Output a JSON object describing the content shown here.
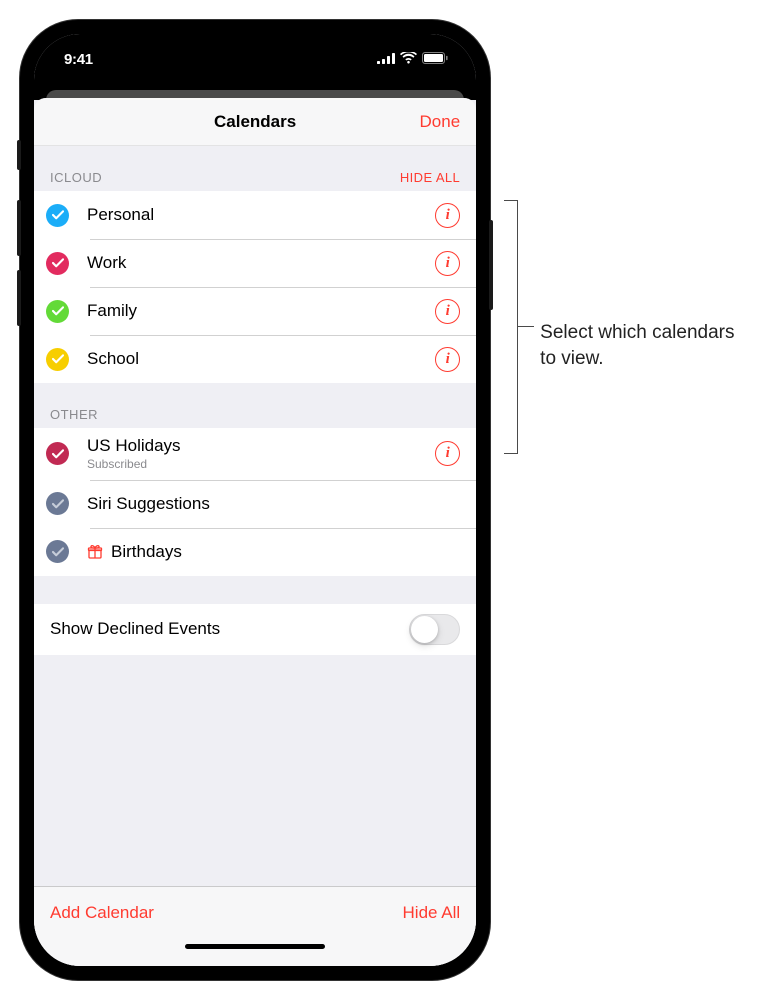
{
  "status": {
    "time": "9:41"
  },
  "sheet": {
    "title": "Calendars",
    "done": "Done"
  },
  "sections": {
    "icloud": {
      "label": "ICLOUD",
      "action": "HIDE ALL",
      "items": [
        {
          "name": "Personal",
          "color": "#1badf8",
          "checkFill": "#ffffff"
        },
        {
          "name": "Work",
          "color": "#e22b5f",
          "checkFill": "#ffffff"
        },
        {
          "name": "Family",
          "color": "#63da38",
          "checkFill": "#ffffff"
        },
        {
          "name": "School",
          "color": "#f7ce00",
          "checkFill": "#ffffff"
        }
      ]
    },
    "other": {
      "label": "OTHER",
      "items": [
        {
          "name": "US Holidays",
          "sub": "Subscribed",
          "color": "#c12a53",
          "checkFill": "#ffffff",
          "info": true
        },
        {
          "name": "Siri Suggestions",
          "color": "#6b7995",
          "checkFill": "#c6cdd9",
          "info": false
        },
        {
          "name": "Birthdays",
          "color": "#6b7995",
          "checkFill": "#c6cdd9",
          "info": false,
          "giftIcon": true
        }
      ]
    }
  },
  "settings": {
    "declined": "Show Declined Events",
    "declinedOn": false
  },
  "bottom": {
    "add": "Add Calendar",
    "hideAll": "Hide All"
  },
  "annotation": "Select which calendars to view."
}
